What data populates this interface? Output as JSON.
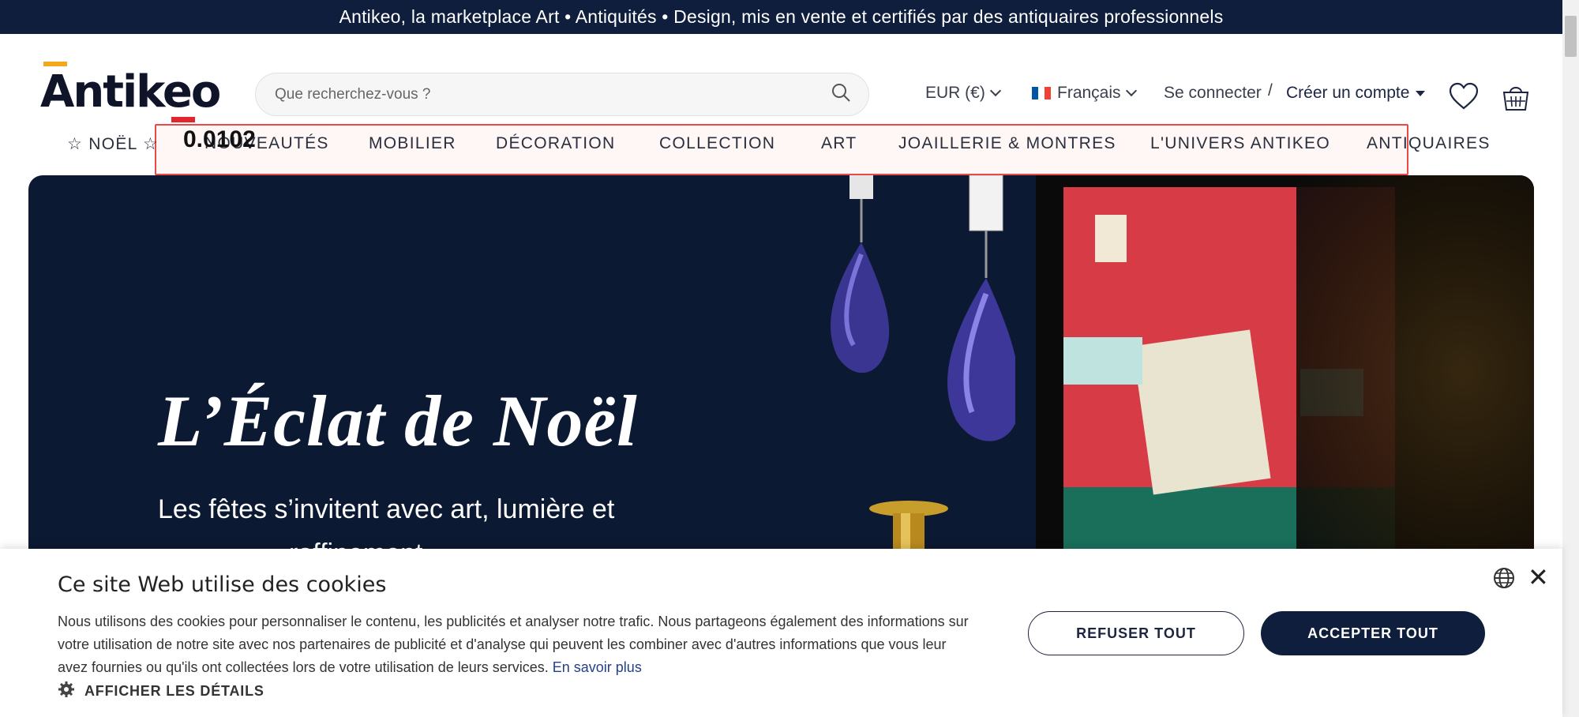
{
  "topbar": {
    "text": "Antikeo, la marketplace Art • Antiquités • Design, mis en vente et certifiés par des antiquaires professionnels"
  },
  "header": {
    "logo_text": "Antikeo",
    "search_placeholder": "Que recherchez-vous ?",
    "currency": "EUR (€)",
    "language": "Français",
    "login": "Se connecter",
    "separator": "/",
    "signup": "Créer un compte"
  },
  "nav": {
    "items": [
      "☆ NOËL ☆",
      "NOUVEAUTÉS",
      "MOBILIER",
      "DÉCORATION",
      "COLLECTION",
      "ART",
      "JOAILLERIE & MONTRES",
      "L'UNIVERS ANTIKEO",
      "ANTIQUAIRES"
    ]
  },
  "overlay": {
    "score": "0.0102"
  },
  "hero": {
    "title": "L’Éclat de Noël",
    "subtitle_line1": "Les fêtes s’invitent avec art, lumière et",
    "subtitle_line2": "raffinement."
  },
  "cookie": {
    "title": "Ce site Web utilise des cookies",
    "body": "Nous utilisons des cookies pour personnaliser le contenu, les publicités et analyser notre trafic. Nous partageons également des informations sur votre utilisation de notre site avec nos partenaires de publicité et d'analyse qui peuvent les combiner avec d'autres informations que vous leur avez fournies ou qu'ils ont collectées lors de votre utilisation de leurs services.",
    "learn_more": "En savoir plus",
    "details": "AFFICHER LES DÉTAILS",
    "refuse": "REFUSER TOUT",
    "accept": "ACCEPTER TOUT",
    "close": "✕"
  },
  "colors": {
    "navy": "#0f1e3d",
    "accent_yellow": "#f2a818",
    "accent_red": "#e3252c",
    "highlight": "#e84a4a"
  }
}
